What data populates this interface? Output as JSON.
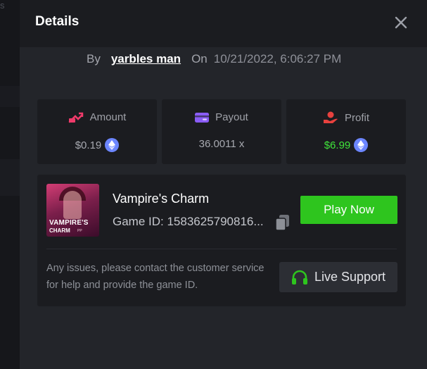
{
  "backdrop": {
    "edge_text": "s"
  },
  "modal": {
    "title": "Details",
    "close_icon": "close-icon"
  },
  "bet": {
    "by_label": "By",
    "username": "yarbles man",
    "on_label": "On",
    "date": "10/21/2022, 6:06:27 PM"
  },
  "stats": {
    "amount": {
      "label": "Amount",
      "value": "$0.19",
      "icon": "amount-icon",
      "currency_icon": "eth-icon"
    },
    "payout": {
      "label": "Payout",
      "value": "36.0011 x",
      "icon": "wallet-icon"
    },
    "profit": {
      "label": "Profit",
      "value": "$6.99",
      "icon": "hand-coin-icon",
      "currency_icon": "eth-icon"
    }
  },
  "game": {
    "name": "Vampire's Charm",
    "id_text": "Game ID: 1583625790816...",
    "thumb_title_1": "VAMPIRE'S",
    "thumb_title_2": "CHARM",
    "thumb_brand": "PP",
    "play_label": "Play Now",
    "copy_icon": "copy-icon"
  },
  "support": {
    "issues_text": "Any issues, please contact the customer service for help and provide the game ID.",
    "button_label": "Live Support",
    "icon": "headset-icon"
  },
  "colors": {
    "accent_green": "#2ec51e",
    "profit_green": "#3fe43a",
    "amount_pink": "#ef3a6a",
    "payout_purple": "#8a5cf6",
    "profit_red": "#e8413e",
    "eth_blue": "#6c86ff"
  }
}
